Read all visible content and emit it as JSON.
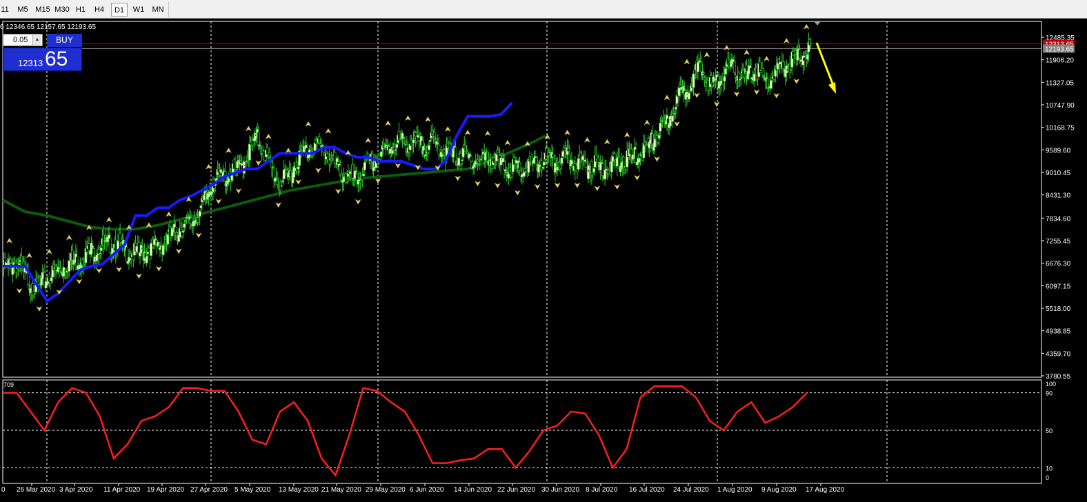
{
  "toolbar": {
    "timeframes": [
      {
        "label": "11",
        "active": false
      },
      {
        "label": "M5",
        "active": false
      },
      {
        "label": "M15",
        "active": false
      },
      {
        "label": "M30",
        "active": false
      },
      {
        "label": "H1",
        "active": false
      },
      {
        "label": "H4",
        "active": false
      },
      {
        "label": "D1",
        "active": true
      },
      {
        "label": "W1",
        "active": false
      },
      {
        "label": "MN",
        "active": false
      }
    ]
  },
  "ohlc_info": "6 12346.65 12157.65 12193.65",
  "trade_panel": {
    "lot_value": "0.05",
    "buy_label": "BUY",
    "price_small": "12313",
    "price_big": "65"
  },
  "colors": {
    "background": "#000000",
    "candle_up": "#ffffc8",
    "candle_wick": "#2ecc2e",
    "blue_line": "#1a1aff",
    "ma_line": "#0c5c0c",
    "oscillator": "#ff1e1e",
    "arrow": "#ffff00",
    "hline_red": "#c00000"
  },
  "chart_data": [
    {
      "type": "candlestick",
      "y_axis_ticks": [
        "12485.35",
        "11906.20",
        "11327.05",
        "10747.90",
        "10168.75",
        "9589.60",
        "9010.45",
        "8431.30",
        "7834.60",
        "7255.45",
        "6676.30",
        "6097.15",
        "5518.00",
        "4938.85",
        "4359.70",
        "3780.55"
      ],
      "price_markers": [
        {
          "value": "12313.65",
          "label": "12313.65",
          "color": "#c00000"
        },
        {
          "value": "12193.65",
          "label": "12193.65",
          "color": "#808080"
        }
      ],
      "x_axis_ticks": [
        "0",
        "26 Mar 2020",
        "3 Apr 2020",
        "11 Apr 2020",
        "19 Apr 2020",
        "27 Apr 2020",
        "5 May 2020",
        "13 May 2020",
        "21 May 2020",
        "29 May 2020",
        "6 Jun 2020",
        "14 Jun 2020",
        "22 Jun 2020",
        "30 Jun 2020",
        "8 Jul 2020",
        "16 Jul 2020",
        "24 Jul 2020",
        "1 Aug 2020",
        "9 Aug 2020",
        "17 Aug 2020"
      ],
      "close_path": [
        [
          0,
          6500
        ],
        [
          10,
          6700
        ],
        [
          20,
          6400
        ],
        [
          30,
          6000
        ],
        [
          40,
          6300
        ],
        [
          50,
          6500
        ],
        [
          60,
          6700
        ],
        [
          70,
          6800
        ],
        [
          80,
          7000
        ],
        [
          90,
          7100
        ],
        [
          100,
          7200
        ],
        [
          110,
          7000
        ],
        [
          120,
          6900
        ],
        [
          130,
          7000
        ],
        [
          140,
          7100
        ],
        [
          150,
          7300
        ],
        [
          160,
          7600
        ],
        [
          170,
          7700
        ],
        [
          180,
          8100
        ],
        [
          190,
          8800
        ],
        [
          200,
          8900
        ],
        [
          210,
          9000
        ],
        [
          220,
          9400
        ],
        [
          230,
          9900
        ],
        [
          240,
          9300
        ],
        [
          250,
          8700
        ],
        [
          260,
          9000
        ],
        [
          270,
          9500
        ],
        [
          280,
          9700
        ],
        [
          290,
          9600
        ],
        [
          300,
          9200
        ],
        [
          310,
          8900
        ],
        [
          320,
          8800
        ],
        [
          330,
          9200
        ],
        [
          340,
          9400
        ],
        [
          350,
          9700
        ],
        [
          360,
          9800
        ],
        [
          370,
          9750
        ],
        [
          380,
          9700
        ],
        [
          390,
          9800
        ],
        [
          400,
          9500
        ],
        [
          410,
          9450
        ],
        [
          420,
          9400
        ],
        [
          430,
          9300
        ],
        [
          440,
          9400
        ],
        [
          450,
          9200
        ],
        [
          460,
          9100
        ],
        [
          470,
          9050
        ],
        [
          480,
          9200
        ],
        [
          490,
          9300
        ],
        [
          500,
          9250
        ],
        [
          510,
          9400
        ],
        [
          520,
          9250
        ],
        [
          530,
          9200
        ],
        [
          540,
          9180
        ],
        [
          550,
          9150
        ],
        [
          560,
          9300
        ],
        [
          570,
          9400
        ],
        [
          580,
          9600
        ],
        [
          590,
          9900
        ],
        [
          600,
          10300
        ],
        [
          610,
          10900
        ],
        [
          620,
          11300
        ],
        [
          630,
          11700
        ],
        [
          640,
          11200
        ],
        [
          650,
          11500
        ],
        [
          660,
          11700
        ],
        [
          670,
          11400
        ],
        [
          680,
          11700
        ],
        [
          690,
          11300
        ],
        [
          700,
          11600
        ],
        [
          710,
          11800
        ],
        [
          720,
          12000
        ],
        [
          730,
          12200
        ]
      ],
      "support_line": [
        [
          0,
          6600
        ],
        [
          20,
          6600
        ],
        [
          30,
          6150
        ],
        [
          40,
          5700
        ],
        [
          50,
          5900
        ],
        [
          60,
          6200
        ],
        [
          70,
          6500
        ],
        [
          80,
          6600
        ],
        [
          90,
          6650
        ],
        [
          100,
          6900
        ],
        [
          110,
          7150
        ],
        [
          120,
          7900
        ],
        [
          130,
          7900
        ],
        [
          140,
          8100
        ],
        [
          150,
          8100
        ],
        [
          160,
          8300
        ],
        [
          170,
          8400
        ],
        [
          180,
          8550
        ],
        [
          190,
          8700
        ],
        [
          200,
          8900
        ],
        [
          210,
          9000
        ],
        [
          220,
          9100
        ],
        [
          230,
          9100
        ],
        [
          240,
          9300
        ],
        [
          250,
          9500
        ],
        [
          260,
          9500
        ],
        [
          270,
          9500
        ],
        [
          280,
          9500
        ],
        [
          290,
          9650
        ],
        [
          300,
          9650
        ],
        [
          310,
          9500
        ],
        [
          320,
          9400
        ],
        [
          330,
          9400
        ],
        [
          340,
          9300
        ],
        [
          350,
          9300
        ],
        [
          360,
          9300
        ],
        [
          370,
          9200
        ],
        [
          380,
          9100
        ],
        [
          390,
          9100
        ],
        [
          400,
          9300
        ],
        [
          410,
          9950
        ],
        [
          420,
          10450
        ],
        [
          430,
          10450
        ],
        [
          440,
          10450
        ],
        [
          450,
          10500
        ],
        [
          460,
          10800
        ]
      ],
      "moving_average": [
        [
          0,
          8300
        ],
        [
          20,
          8000
        ],
        [
          40,
          7900
        ],
        [
          60,
          7750
        ],
        [
          80,
          7600
        ],
        [
          100,
          7550
        ],
        [
          120,
          7550
        ],
        [
          140,
          7650
        ],
        [
          160,
          7800
        ],
        [
          180,
          7950
        ],
        [
          200,
          8100
        ],
        [
          220,
          8250
        ],
        [
          240,
          8400
        ],
        [
          260,
          8550
        ],
        [
          280,
          8650
        ],
        [
          300,
          8750
        ],
        [
          320,
          8850
        ],
        [
          340,
          8900
        ],
        [
          360,
          8950
        ],
        [
          380,
          9000
        ],
        [
          400,
          9050
        ],
        [
          420,
          9100
        ],
        [
          440,
          9300
        ],
        [
          460,
          9550
        ],
        [
          480,
          9800
        ],
        [
          490,
          9950
        ]
      ]
    },
    {
      "type": "line",
      "name": "",
      "y_axis_ticks": [
        "100",
        "90",
        "50",
        "10",
        "0"
      ],
      "y_label_left": "709",
      "ylim": [
        0,
        100
      ],
      "values": [
        [
          0,
          90
        ],
        [
          10,
          90
        ],
        [
          20,
          70
        ],
        [
          30,
          50
        ],
        [
          40,
          80
        ],
        [
          50,
          95
        ],
        [
          60,
          90
        ],
        [
          70,
          65
        ],
        [
          80,
          20
        ],
        [
          90,
          35
        ],
        [
          100,
          60
        ],
        [
          110,
          65
        ],
        [
          120,
          75
        ],
        [
          130,
          95
        ],
        [
          140,
          95
        ],
        [
          150,
          92
        ],
        [
          160,
          92
        ],
        [
          170,
          70
        ],
        [
          180,
          40
        ],
        [
          190,
          35
        ],
        [
          200,
          70
        ],
        [
          210,
          80
        ],
        [
          220,
          60
        ],
        [
          230,
          20
        ],
        [
          240,
          2
        ],
        [
          250,
          45
        ],
        [
          260,
          95
        ],
        [
          270,
          92
        ],
        [
          280,
          80
        ],
        [
          290,
          70
        ],
        [
          300,
          45
        ],
        [
          310,
          15
        ],
        [
          320,
          15
        ],
        [
          330,
          18
        ],
        [
          340,
          20
        ],
        [
          350,
          30
        ],
        [
          360,
          30
        ],
        [
          370,
          10
        ],
        [
          380,
          28
        ],
        [
          390,
          50
        ],
        [
          400,
          55
        ],
        [
          410,
          70
        ],
        [
          420,
          68
        ],
        [
          430,
          45
        ],
        [
          440,
          10
        ],
        [
          450,
          30
        ],
        [
          460,
          85
        ],
        [
          470,
          97
        ],
        [
          480,
          97
        ],
        [
          490,
          97
        ],
        [
          500,
          85
        ],
        [
          510,
          60
        ],
        [
          520,
          50
        ],
        [
          530,
          70
        ],
        [
          540,
          80
        ],
        [
          550,
          58
        ],
        [
          560,
          65
        ],
        [
          570,
          75
        ],
        [
          580,
          90
        ]
      ]
    }
  ]
}
